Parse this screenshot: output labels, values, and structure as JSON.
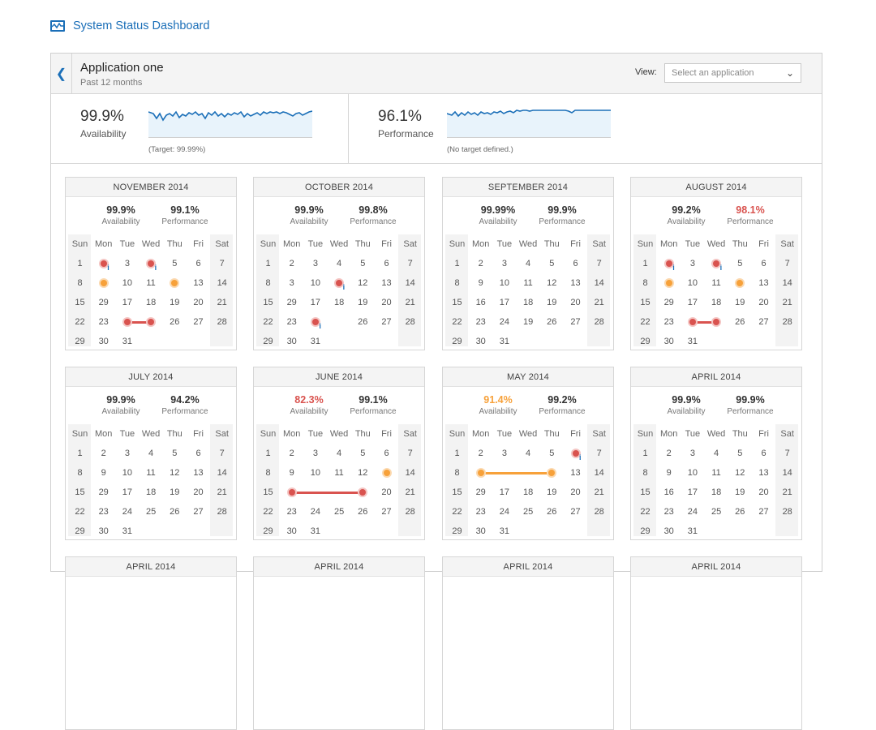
{
  "app": {
    "title": "System Status Dashboard"
  },
  "header": {
    "app_name": "Application one",
    "subtitle": "Past 12 months",
    "view_label": "View:",
    "view_placeholder": "Select an application"
  },
  "summary": {
    "availability": {
      "value": "99.9%",
      "label": "Availability",
      "note": "(Target: 99.99%)"
    },
    "performance": {
      "value": "96.1%",
      "label": "Performance",
      "note": "(No target defined.)"
    }
  },
  "weekdays": [
    "Sun",
    "Mon",
    "Tue",
    "Wed",
    "Thu",
    "Fri",
    "Sat"
  ],
  "stat_labels": {
    "availability": "Availability",
    "performance": "Performance"
  },
  "months": [
    {
      "title": "NOVEMBER 2014",
      "availability": "99.9%",
      "performance": "99.1%",
      "avail_color": "",
      "perf_color": "",
      "rows": [
        [
          "1",
          "",
          "3",
          "",
          "5",
          "6",
          "7"
        ],
        [
          "8",
          "",
          "10",
          "11",
          "",
          "13",
          "14"
        ],
        [
          "15",
          "29",
          "17",
          "18",
          "19",
          "20",
          "21"
        ],
        [
          "22",
          "23",
          "",
          "",
          "26",
          "27",
          "28"
        ],
        [
          "29",
          "30",
          "31",
          "",
          "",
          "",
          ""
        ]
      ]
    },
    {
      "title": "OCTOBER 2014",
      "availability": "99.9%",
      "performance": "99.8%",
      "avail_color": "",
      "perf_color": "",
      "rows": [
        [
          "1",
          "2",
          "3",
          "4",
          "5",
          "6",
          "7"
        ],
        [
          "8",
          "3",
          "10",
          "",
          "12",
          "13",
          "14"
        ],
        [
          "15",
          "29",
          "17",
          "18",
          "19",
          "20",
          "21"
        ],
        [
          "22",
          "23",
          "",
          "",
          "26",
          "27",
          "28"
        ],
        [
          "29",
          "30",
          "31",
          "",
          "",
          "",
          ""
        ]
      ]
    },
    {
      "title": "SEPTEMBER 2014",
      "availability": "99.99%",
      "performance": "99.9%",
      "avail_color": "",
      "perf_color": "",
      "rows": [
        [
          "1",
          "2",
          "3",
          "4",
          "5",
          "6",
          "7"
        ],
        [
          "8",
          "9",
          "10",
          "11",
          "12",
          "13",
          "14"
        ],
        [
          "15",
          "16",
          "17",
          "18",
          "19",
          "20",
          "21"
        ],
        [
          "22",
          "23",
          "24",
          "19",
          "26",
          "27",
          "28"
        ],
        [
          "29",
          "30",
          "31",
          "",
          "",
          "",
          ""
        ]
      ]
    },
    {
      "title": "AUGUST 2014",
      "availability": "99.2%",
      "performance": "98.1%",
      "avail_color": "",
      "perf_color": "red",
      "rows": [
        [
          "1",
          "",
          "3",
          "",
          "5",
          "6",
          "7"
        ],
        [
          "8",
          "",
          "10",
          "11",
          "",
          "13",
          "14"
        ],
        [
          "15",
          "29",
          "17",
          "18",
          "19",
          "20",
          "21"
        ],
        [
          "22",
          "23",
          "",
          "",
          "26",
          "27",
          "28"
        ],
        [
          "29",
          "30",
          "31",
          "",
          "",
          "",
          ""
        ]
      ]
    },
    {
      "title": "JULY 2014",
      "availability": "99.9%",
      "performance": "94.2%",
      "avail_color": "",
      "perf_color": "",
      "rows": [
        [
          "1",
          "2",
          "3",
          "4",
          "5",
          "6",
          "7"
        ],
        [
          "8",
          "9",
          "10",
          "11",
          "12",
          "13",
          "14"
        ],
        [
          "15",
          "29",
          "17",
          "18",
          "19",
          "20",
          "21"
        ],
        [
          "22",
          "23",
          "24",
          "25",
          "26",
          "27",
          "28"
        ],
        [
          "29",
          "30",
          "31",
          "",
          "",
          "",
          ""
        ]
      ]
    },
    {
      "title": "JUNE 2014",
      "availability": "82.3%",
      "performance": "99.1%",
      "avail_color": "red",
      "perf_color": "",
      "rows": [
        [
          "1",
          "2",
          "3",
          "4",
          "5",
          "6",
          "7"
        ],
        [
          "8",
          "9",
          "10",
          "11",
          "12",
          "",
          "14"
        ],
        [
          "15",
          "",
          "",
          "",
          "",
          "20",
          "21"
        ],
        [
          "22",
          "23",
          "24",
          "25",
          "26",
          "27",
          "28"
        ],
        [
          "29",
          "30",
          "31",
          "",
          "",
          "",
          ""
        ]
      ]
    },
    {
      "title": "MAY 2014",
      "availability": "91.4%",
      "performance": "99.2%",
      "avail_color": "orange",
      "perf_color": "",
      "rows": [
        [
          "1",
          "2",
          "3",
          "4",
          "5",
          "",
          "7"
        ],
        [
          "8",
          "",
          "",
          "",
          "",
          "13",
          "14"
        ],
        [
          "15",
          "29",
          "17",
          "18",
          "19",
          "20",
          "21"
        ],
        [
          "22",
          "23",
          "24",
          "25",
          "26",
          "27",
          "28"
        ],
        [
          "29",
          "30",
          "31",
          "",
          "",
          "",
          ""
        ]
      ]
    },
    {
      "title": "APRIL 2014",
      "availability": "99.9%",
      "performance": "99.9%",
      "avail_color": "",
      "perf_color": "",
      "rows": [
        [
          "1",
          "2",
          "3",
          "4",
          "5",
          "6",
          "7"
        ],
        [
          "8",
          "9",
          "10",
          "11",
          "12",
          "13",
          "14"
        ],
        [
          "15",
          "16",
          "17",
          "18",
          "19",
          "20",
          "21"
        ],
        [
          "22",
          "23",
          "24",
          "25",
          "26",
          "27",
          "28"
        ],
        [
          "29",
          "30",
          "31",
          "",
          "",
          "",
          ""
        ]
      ]
    },
    {
      "title": "APRIL 2014"
    },
    {
      "title": "APRIL 2014"
    },
    {
      "title": "APRIL 2014"
    },
    {
      "title": "APRIL 2014"
    }
  ],
  "colors": {
    "accent": "#1b6fb8",
    "alert_red": "#d9534f",
    "alert_orange": "#f7a13a"
  }
}
